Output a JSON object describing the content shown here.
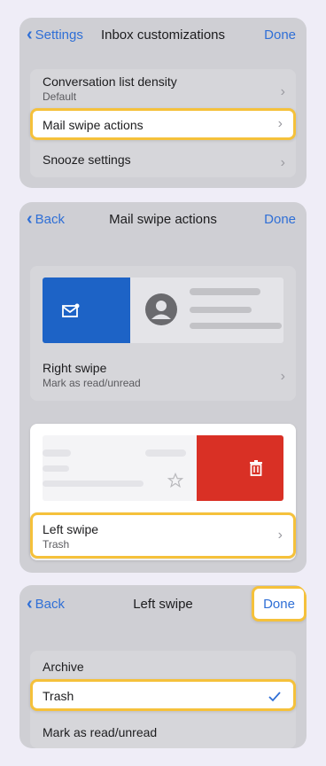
{
  "panel1": {
    "back_label": "Settings",
    "title": "Inbox customizations",
    "done_label": "Done",
    "rows": [
      {
        "label": "Conversation list density",
        "sub": "Default"
      },
      {
        "label": "Mail swipe actions"
      },
      {
        "label": "Snooze settings"
      }
    ]
  },
  "panel2": {
    "back_label": "Back",
    "title": "Mail swipe actions",
    "done_label": "Done",
    "right_swipe": {
      "label": "Right swipe",
      "value": "Mark as read/unread"
    },
    "left_swipe": {
      "label": "Left swipe",
      "value": "Trash"
    }
  },
  "panel3": {
    "back_label": "Back",
    "title": "Left swipe",
    "done_label": "Done",
    "options": [
      {
        "label": "Archive",
        "selected": false
      },
      {
        "label": "Trash",
        "selected": true
      },
      {
        "label": "Mark as read/unread",
        "selected": false
      }
    ]
  },
  "colors": {
    "accent": "#2f6fd6",
    "highlight": "#f5c13b",
    "right_swipe_bg": "#1d63c6",
    "left_swipe_bg": "#d93025"
  },
  "icons": {
    "back": "chevron-left-icon",
    "row_arrow": "chevron-right-icon",
    "mark_read": "mail-read-icon",
    "avatar": "avatar-icon",
    "trash": "trash-icon",
    "star": "star-icon",
    "check": "checkmark-icon"
  }
}
